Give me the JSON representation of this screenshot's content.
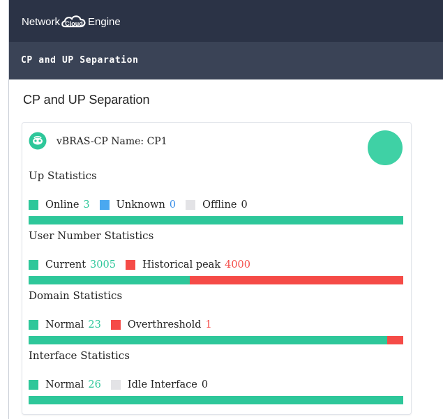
{
  "header": {
    "brand_prefix": "Network",
    "brand_cloud": "Cloud",
    "brand_suffix": "Engine"
  },
  "breadcrumb": {
    "label": "CP and UP Separation"
  },
  "page": {
    "title": "CP and UP Separation"
  },
  "card": {
    "name_label": "vBRAS-CP Name: CP1",
    "sections": [
      {
        "title": "Up Statistics",
        "items": [
          {
            "label": "Online",
            "value": "3",
            "color": "#2ec79a"
          },
          {
            "label": "Unknown",
            "value": "0",
            "color": "#4aa8f0"
          },
          {
            "label": "Offline",
            "value": "0",
            "color": "#e3e3e6"
          }
        ],
        "bar": [
          1,
          0,
          0
        ]
      },
      {
        "title": "User Number Statistics",
        "items": [
          {
            "label": "Current",
            "value": "3005",
            "color": "#2ec79a"
          },
          {
            "label": "Historical peak",
            "value": "4000",
            "color": "#f54b47"
          }
        ],
        "bar": [
          0.43,
          0.57
        ]
      },
      {
        "title": "Domain Statistics",
        "items": [
          {
            "label": "Normal",
            "value": "23",
            "color": "#2ec79a"
          },
          {
            "label": "Overthreshold",
            "value": "1",
            "color": "#f54b47"
          }
        ],
        "bar": [
          0.958,
          0.042
        ]
      },
      {
        "title": "Interface Statistics",
        "items": [
          {
            "label": "Normal",
            "value": "26",
            "color": "#2ec79a"
          },
          {
            "label": "Idle Interface",
            "value": "0",
            "color": "#e3e3e6"
          }
        ],
        "bar": [
          1,
          0
        ]
      }
    ]
  },
  "colors": {
    "header_bg": "#2b3346",
    "crumb_bg": "#3a4356",
    "accent_green": "#2ec79a",
    "accent_blue": "#4aa8f0",
    "accent_red": "#f54b47",
    "neutral_grey": "#e3e3e6"
  }
}
